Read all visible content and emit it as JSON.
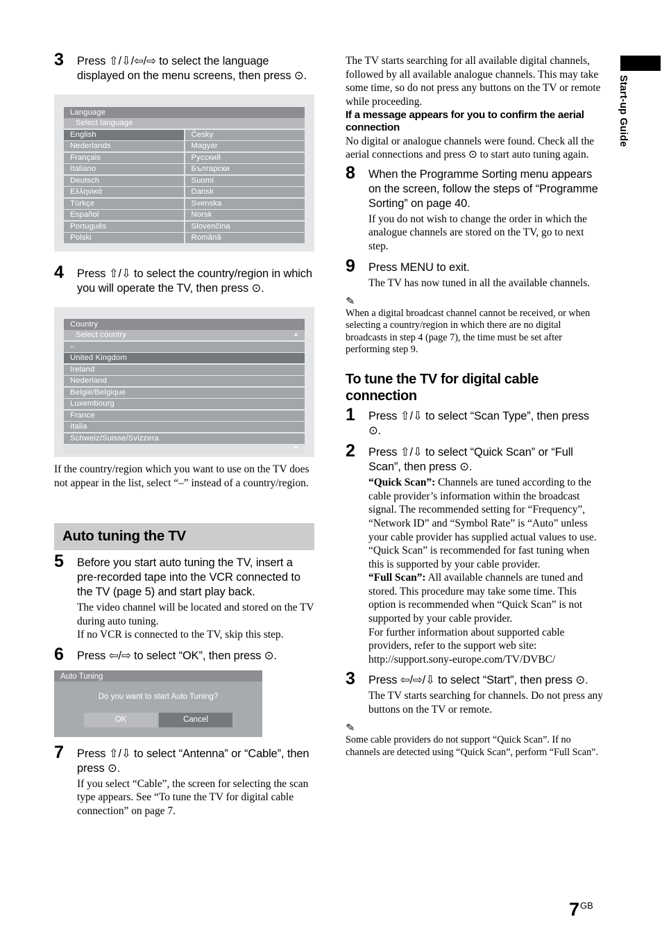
{
  "page": {
    "number": "7",
    "region_code": "GB",
    "side_tab_label": "Start-up Guide"
  },
  "left_column": {
    "step3": {
      "number": "3",
      "text": "Press ⇧/⇩/⇦/⇨ to select the language displayed on the menu screens, then press ⊙."
    },
    "language_osd": {
      "title": "Language",
      "subtitle": "Select language",
      "left_items": [
        "English",
        "Nederlands",
        "Français",
        "Italiano",
        "Deutsch",
        "Ελληνικά",
        "Türkçe",
        "Español",
        "Português",
        "Polski"
      ],
      "right_items": [
        "Česky",
        "Magyar",
        "Русский",
        "Български",
        "Suomi",
        "Dansk",
        "Svenska",
        "Norsk",
        "Slovenčina",
        "Română"
      ],
      "selected": "English"
    },
    "step4": {
      "number": "4",
      "text": "Press ⇧/⇩ to select the country/region in which you will operate the TV, then press ⊙."
    },
    "country_osd": {
      "title": "Country",
      "subtitle": "Select country",
      "scroll_up_icon": "arrow-up-icon",
      "scroll_down_icon": "arrow-down-icon",
      "items": [
        "–",
        "United Kingdom",
        "Ireland",
        "Nederland",
        "België/Belgique",
        "Luxembourg",
        "France",
        "Italia",
        "Schweiz/Suisse/Svizzera"
      ],
      "selected": "United Kingdom"
    },
    "after_country_note": "If the country/region which you want to use on the TV does not appear in the list, select “–” instead of a country/region.",
    "section_heading": "Auto tuning the TV",
    "step5": {
      "number": "5",
      "text": "Before you start auto tuning the TV, insert a pre-recorded tape into the VCR connected to the TV (page 5) and start play back.",
      "sub1": "The video channel will be located and stored on the TV during auto tuning.",
      "sub2": "If no VCR is connected to the TV, skip this step."
    },
    "step6": {
      "number": "6",
      "text": "Press ⇦/⇨ to select “OK”, then press ⊙."
    },
    "auto_tuning_dialog": {
      "title": "Auto Tuning",
      "message": "Do you want to start Auto Tuning?",
      "ok_label": "OK",
      "cancel_label": "Cancel"
    },
    "step7": {
      "number": "7",
      "text": "Press ⇧/⇩ to select “Antenna” or “Cable”, then press ⊙.",
      "sub": "If you select “Cable”, the screen for selecting the scan type appears. See “To tune the TV for digital cable connection” on page 7."
    }
  },
  "right_column": {
    "intro": "The TV starts searching for all available digital channels, followed by all available analogue channels. This may take some time, so do not press any buttons on the TV or remote while proceeding.",
    "aerial_heading": "If a message appears for you to confirm the aerial connection",
    "aerial_body": "No digital or analogue channels were found. Check all the aerial connections and press ⊙ to start auto tuning again.",
    "step8": {
      "number": "8",
      "text": "When the Programme Sorting menu appears on the screen, follow the steps of “Programme Sorting” on page 40.",
      "sub": "If you do not wish to change the order in which the analogue channels are stored on the TV, go to next step."
    },
    "step9": {
      "number": "9",
      "text": "Press MENU to exit.",
      "sub": "The TV has now tuned in all the available channels."
    },
    "note1": {
      "mark": "✎",
      "text": "When a digital broadcast channel cannot be received, or when selecting a country/region in which there are no digital broadcasts in step 4 (page 7), the time must be set after performing step 9."
    },
    "cable_heading": "To tune the TV for digital cable connection",
    "cstep1": {
      "number": "1",
      "text": "Press ⇧/⇩ to select “Scan Type”, then press ⊙."
    },
    "cstep2": {
      "number": "2",
      "text": "Press ⇧/⇩ to select “Quick Scan” or “Full Scan”, then press ⊙.",
      "quick_label": "“Quick Scan”:",
      "quick_body": " Channels are tuned according to the cable provider’s information within the broadcast signal. The recommended setting for “Frequency”, “Network ID” and “Symbol Rate” is “Auto” unless your cable provider has supplied actual values to use. “Quick Scan” is recommended for fast tuning when this is supported by your cable provider.",
      "full_label": "“Full Scan”:",
      "full_body": " All available channels are tuned and stored. This procedure may take some time. This option is recommended when “Quick Scan” is not supported by your cable provider.",
      "further_info": "For further information about supported cable providers, refer to the support web site: http://support.sony-europe.com/TV/DVBC/"
    },
    "cstep3": {
      "number": "3",
      "text": "Press ⇦/⇨/⇩ to select “Start”, then press ⊙.",
      "sub": "The TV starts searching for channels. Do not press any buttons on the TV or remote."
    },
    "note2": {
      "mark": "✎",
      "text": "Some cable providers do not support “Quick Scan”. If no channels are detected using “Quick Scan”, perform “Full Scan”."
    }
  }
}
